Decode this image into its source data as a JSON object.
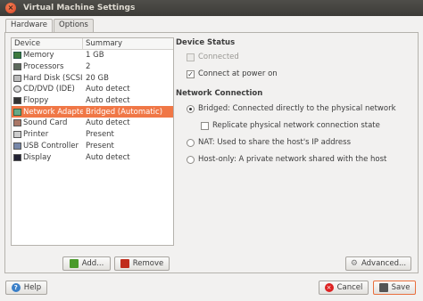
{
  "window": {
    "title": "Virtual Machine Settings"
  },
  "tabs": [
    {
      "label": "Hardware"
    },
    {
      "label": "Options"
    }
  ],
  "device_list": {
    "columns": [
      "Device",
      "Summary"
    ],
    "rows": [
      {
        "device": "Memory",
        "summary": "1 GB",
        "icon": "memory-icon"
      },
      {
        "device": "Processors",
        "summary": "2",
        "icon": "processor-icon"
      },
      {
        "device": "Hard Disk (SCSI)",
        "summary": "20 GB",
        "icon": "hard-disk-icon"
      },
      {
        "device": "CD/DVD (IDE)",
        "summary": "Auto detect",
        "icon": "cd-dvd-icon"
      },
      {
        "device": "Floppy",
        "summary": "Auto detect",
        "icon": "floppy-icon"
      },
      {
        "device": "Network Adapter",
        "summary": "Bridged (Automatic)",
        "icon": "network-adapter-icon",
        "selected": true
      },
      {
        "device": "Sound Card",
        "summary": "Auto detect",
        "icon": "sound-card-icon"
      },
      {
        "device": "Printer",
        "summary": "Present",
        "icon": "printer-icon"
      },
      {
        "device": "USB Controller",
        "summary": "Present",
        "icon": "usb-icon"
      },
      {
        "device": "Display",
        "summary": "Auto detect",
        "icon": "display-icon"
      }
    ]
  },
  "buttons": {
    "add": "Add...",
    "remove": "Remove",
    "advanced": "Advanced...",
    "help": "Help",
    "cancel": "Cancel",
    "save": "Save"
  },
  "device_status": {
    "title": "Device Status",
    "connected": {
      "label": "Connected",
      "checked": false,
      "disabled": true
    },
    "connect_at_power_on": {
      "label": "Connect at power on",
      "checked": true
    }
  },
  "network_connection": {
    "title": "Network Connection",
    "bridged": {
      "label": "Bridged: Connected directly to the physical network",
      "selected": true
    },
    "replicate": {
      "label": "Replicate physical network connection state",
      "checked": false
    },
    "nat": {
      "label": "NAT: Used to share the host's IP address",
      "selected": false
    },
    "host_only": {
      "label": "Host-only: A private network shared with the host",
      "selected": false
    }
  },
  "colors": {
    "selection": "#f07746",
    "titlebar": "#3c3b37",
    "close_button": "#d8452a"
  }
}
